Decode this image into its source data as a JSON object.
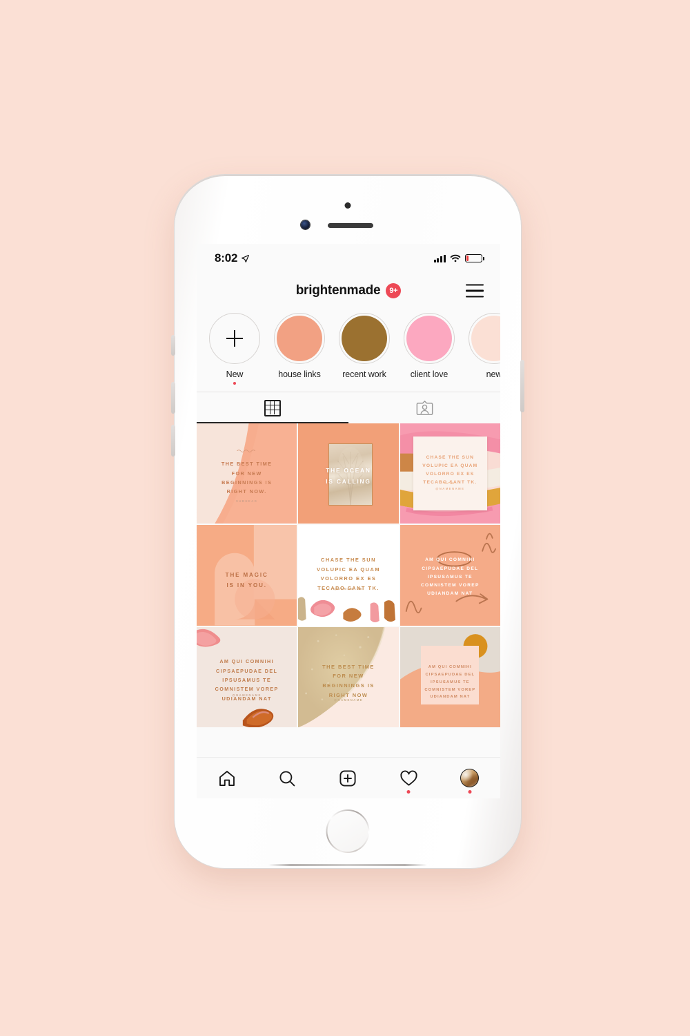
{
  "canvas": {
    "background_color": "#fbe0d5"
  },
  "device": {
    "name": "iPhone",
    "body_color": "#ffffff"
  },
  "status_bar": {
    "time": "8:02",
    "location_icon": "location-arrow-icon",
    "signal_icon": "cellular-bars-icon",
    "wifi_icon": "wifi-icon",
    "battery_icon": "battery-low-icon",
    "battery_level_percent": 14,
    "battery_color": "#ec3b3b"
  },
  "header": {
    "username": "brightenmade",
    "unread_badge": "9+",
    "badge_color": "#ed4956",
    "menu_icon": "hamburger-menu-icon"
  },
  "highlights": [
    {
      "label": "New",
      "type": "add",
      "icon": "plus-icon",
      "color": "#ffffff",
      "has_dot": true
    },
    {
      "label": "house links",
      "type": "cover",
      "color": "#f2a183",
      "has_dot": false
    },
    {
      "label": "recent work",
      "type": "cover",
      "color": "#9b7130",
      "has_dot": false
    },
    {
      "label": "client love",
      "type": "cover",
      "color": "#fca8c0",
      "has_dot": false
    },
    {
      "label": "new",
      "type": "cover",
      "color": "#fbe0d5",
      "has_dot": false
    }
  ],
  "tabs": [
    {
      "id": "grid",
      "icon": "grid-icon",
      "active": true
    },
    {
      "id": "tagged",
      "icon": "tagged-person-icon",
      "active": false
    }
  ],
  "posts": [
    {
      "id": "post-1",
      "headline": "THE BEST TIME\nFOR NEW\nBEGINNINGS IS\nRIGHT NOW.",
      "subhead": "SUBHEAD",
      "text_color": "#c77b52",
      "bg_color": "#f7e4da",
      "accent_color": "#f7b395",
      "style": "diagonal-wash"
    },
    {
      "id": "post-2",
      "headline": "THE OCEAN\nIS CALLING",
      "subhead": "",
      "text_color": "#ffffff",
      "bg_color": "#f2a078",
      "accent_color": "#c98f5e",
      "style": "framed-photo"
    },
    {
      "id": "post-3",
      "headline": "CHASE THE SUN\nVOLUPIC EA QUAM\nVOLORRO EX ES\nTECABO SANT TK.",
      "subhead": "@NAMENAME",
      "text_color": "#e8a377",
      "bg_color": "#faf0e9",
      "accent_color": "#f59fb5",
      "style": "card-on-brushstrokes"
    },
    {
      "id": "post-4",
      "headline": "THE MAGIC\nIS IN YOU.",
      "subhead": "",
      "text_color": "#bb6f44",
      "bg_color": "#f6ab85",
      "accent_color": "#f7c5ab",
      "style": "arch-shapes"
    },
    {
      "id": "post-5",
      "headline": "CHASE THE SUN\nVOLUPIC EA QUAM\nVOLORRO EX ES\nTECABO SANT TK.",
      "subhead": "@NAMENAME",
      "text_color": "#c78a4e",
      "bg_color": "#ffffff",
      "accent_color": "#e98a8a",
      "style": "white-brushstrokes"
    },
    {
      "id": "post-6",
      "headline": "AM QUI COMNIHI\nCIPSAEPUDAE DEL\nIPSUSAMUS TE\nCOMNISTEM VOREP\nUDIANDAM NAT",
      "subhead": "",
      "text_color": "#ffffff",
      "bg_color": "#f5ab88",
      "accent_color": "#b9714a",
      "style": "circled-doodles"
    },
    {
      "id": "post-7",
      "headline": "AM QUI COMNIHI\nCIPSAEPUDAE DEL\nIPSUSAMUS TE\nCOMNISTEM VOREP\nUDIANDAM NAT",
      "subhead": "@NAMENAME",
      "text_color": "#c07c4c",
      "bg_color": "#f2e6df",
      "accent_color": "#ef8d8d",
      "style": "cream-brushstrokes"
    },
    {
      "id": "post-8",
      "headline": "THE BEST TIME\nFOR NEW\nBEGINNINGS IS\nRIGHT NOW",
      "subhead": "@NAMENAME",
      "text_color": "#bc8c4e",
      "bg_color": "#fbeae2",
      "accent_color": "#d9c49b",
      "style": "textured-swoosh"
    },
    {
      "id": "post-9",
      "headline": "AM QUI COMNIHI\nCIPSAEPUDAE DEL\nIPSUSAMUS TE\nCOMNISTEM VOREP\nUDIANDAM NAT",
      "subhead": "",
      "text_color": "#d08b64",
      "bg_color": "#e3dbd2",
      "accent_color": "#d9911f",
      "style": "card-circle"
    }
  ],
  "bottom_nav": [
    {
      "id": "home",
      "icon": "home-icon",
      "has_dot": false
    },
    {
      "id": "search",
      "icon": "search-icon",
      "has_dot": false
    },
    {
      "id": "create",
      "icon": "plus-square-icon",
      "has_dot": false
    },
    {
      "id": "activity",
      "icon": "heart-icon",
      "has_dot": true
    },
    {
      "id": "profile",
      "icon": "avatar-icon",
      "has_dot": true
    }
  ]
}
